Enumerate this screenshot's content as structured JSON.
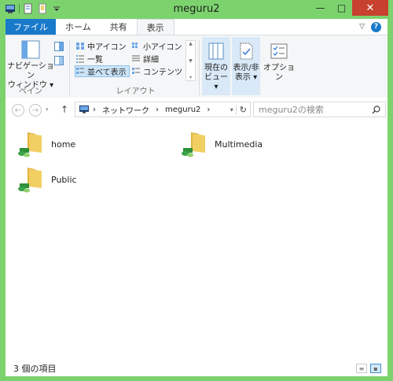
{
  "window": {
    "title": "meguru2",
    "minimize": "—",
    "maximize": "□",
    "close": "✕"
  },
  "tabs": [
    {
      "label": "ファイル"
    },
    {
      "label": "ホーム"
    },
    {
      "label": "共有"
    },
    {
      "label": "表示"
    }
  ],
  "ribbon": {
    "pane_group": {
      "label": "ペイン",
      "nav_pane_line1": "ナビゲーション",
      "nav_pane_line2": "ウィンドウ ▾"
    },
    "layout_group": {
      "label": "レイアウト",
      "items": [
        {
          "label": "中アイコン"
        },
        {
          "label": "小アイコン"
        },
        {
          "label": "一覧"
        },
        {
          "label": "詳細"
        },
        {
          "label": "並べて表示"
        },
        {
          "label": "コンテンツ"
        }
      ]
    },
    "current_view": {
      "line1": "現在の",
      "line2": "ビュー ▾"
    },
    "show_hide": {
      "line1": "表示/非",
      "line2": "表示 ▾"
    },
    "options": {
      "label": "オプション"
    }
  },
  "address": {
    "segments": [
      "ネットワーク",
      "meguru2"
    ],
    "search_placeholder": "meguru2の検索"
  },
  "items": [
    {
      "name": "home"
    },
    {
      "name": "Multimedia"
    },
    {
      "name": "Public"
    }
  ],
  "status": {
    "count": "3 個の項目"
  },
  "colors": {
    "frame": "#7cd36e",
    "file_tab": "#1979ca",
    "close": "#c7412e",
    "folder": "#f2cf63"
  }
}
